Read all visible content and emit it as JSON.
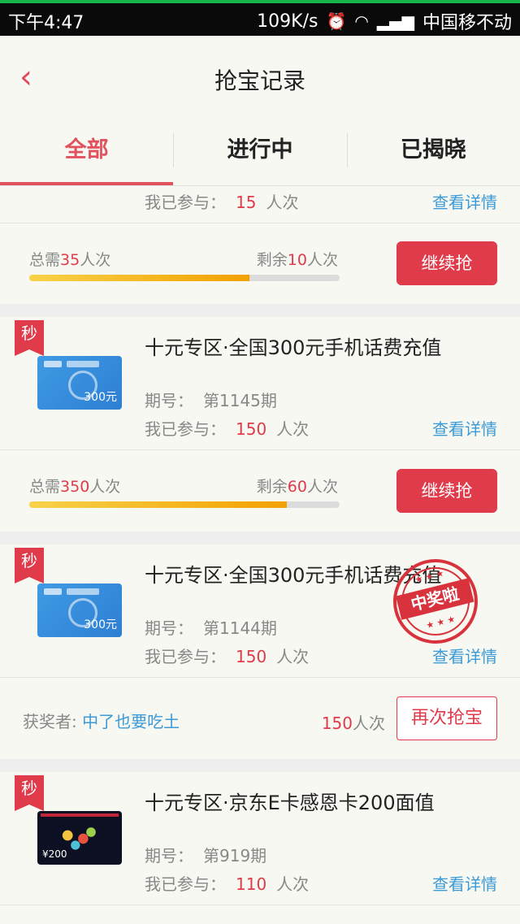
{
  "status_bar": {
    "time": "下午4:47",
    "speed": "109K/s",
    "carrier": "中国移不动"
  },
  "nav": {
    "title": "抢宝记录"
  },
  "tabs": [
    "全部",
    "进行中",
    "已揭晓"
  ],
  "common": {
    "participated": "我已参与：",
    "unit": "人次",
    "issue_label": "期号：",
    "detail": "查看详情",
    "continue": "继续抢",
    "again": "再次抢宝",
    "winner_label": "获奖者:",
    "badge": "秒"
  },
  "card1": {
    "participated_num": "15",
    "need_prefix": "总需",
    "need_num": "35",
    "need_suffix": "人次",
    "remain_prefix": "剩余",
    "remain_num": "10",
    "remain_suffix": "人次",
    "progress": 0.71
  },
  "card2": {
    "name": "十元专区·全国300元手机话费充值",
    "issue": "第1145期",
    "participated_num": "150",
    "need_prefix": "总需",
    "need_num": "350",
    "need_suffix": "人次",
    "remain_prefix": "剩余",
    "remain_num": "60",
    "remain_suffix": "人次",
    "progress": 0.83,
    "thumb_amount": "300元"
  },
  "card3": {
    "name": "十元专区·全国300元手机话费充值",
    "issue": "第1144期",
    "participated_num": "150",
    "winner": "中了也要吃土",
    "count_num": "150",
    "count_suffix": "人次",
    "stamp": "中奖啦",
    "thumb_amount": "300元"
  },
  "card4": {
    "name": "十元专区·京东E卡感恩卡200面值",
    "issue": "第919期",
    "participated_num": "110",
    "thumb_amount": "¥200"
  }
}
